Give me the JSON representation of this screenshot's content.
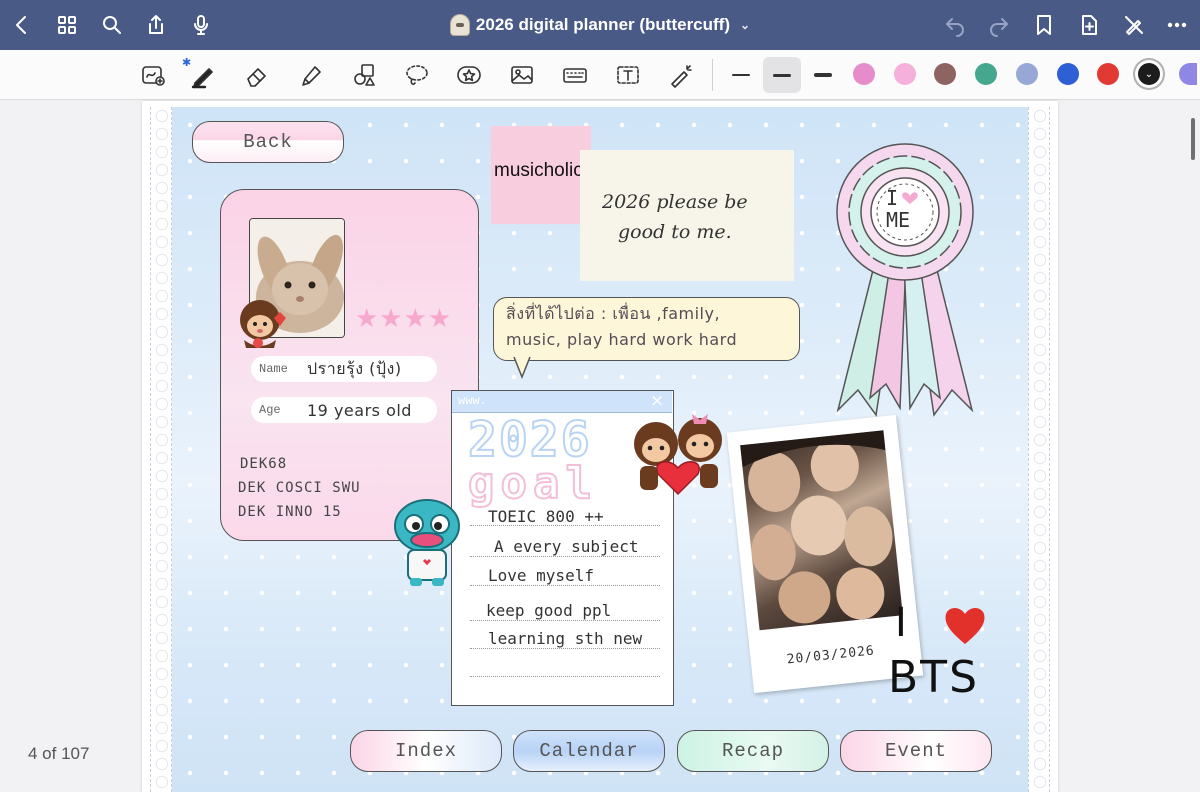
{
  "app": {
    "title": "2026 digital planner (buttercuff)",
    "page_counter": "4 of 107"
  },
  "toolbar": {
    "tools": [
      "lasso-zoom",
      "pen",
      "eraser",
      "highlighter",
      "shapes",
      "lasso",
      "sticker",
      "image",
      "keyboard",
      "text",
      "laser-pointer"
    ],
    "stroke_sizes": [
      "thin",
      "medium",
      "thick"
    ],
    "selected_stroke": "medium",
    "colors": [
      "#e58ccb",
      "#f5b0dc",
      "#8e6462",
      "#45a88e",
      "#97a8d6",
      "#2f5fd4",
      "#e03a33",
      "#1c1c1c",
      "#8f86e6"
    ],
    "selected_color": "#1c1c1c"
  },
  "planner": {
    "back_label": "Back",
    "profile": {
      "stars": "★★★★",
      "name_label": "Name",
      "name_value": "ปรายรุ้ง (ปุ้ง)",
      "age_label": "Age",
      "age_value": "19 years old",
      "lines": [
        "DEK68",
        "DEK COSCI SWU",
        "DEK INNO 15"
      ]
    },
    "music_label": "musicholic",
    "note": {
      "line1": "2026  please  be",
      "line2": "good    to    me."
    },
    "bubble": {
      "line1": "สิ่งที่ได้ไปต่อ : เพื่อน ,family,",
      "line2": "music, play hard work hard"
    },
    "goal_window": {
      "url_label": "www.",
      "close": "×",
      "year": "2026",
      "goal": "goal",
      "items": [
        "TOEIC 800 ++",
        "A  every subject",
        "Love myself",
        "keep good ppl",
        "learning sth new"
      ]
    },
    "rosette": {
      "line1": "I",
      "line2": "ME"
    },
    "polaroid": {
      "date": "20/03/2026"
    },
    "bts": {
      "i_text": "I",
      "bts_text": "BTS"
    },
    "nav": {
      "index": "Index",
      "calendar": "Calendar",
      "recap": "Recap",
      "event": "Event"
    }
  }
}
